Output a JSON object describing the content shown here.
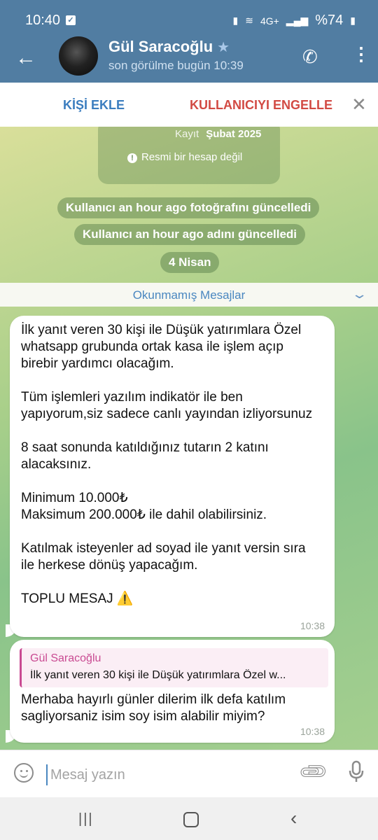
{
  "status_bar": {
    "time": "10:40",
    "network": "4G+",
    "battery": "%74"
  },
  "header": {
    "name": "Gül Saracoğlu",
    "last_seen": "son görülme bugün 10:39"
  },
  "action_bar": {
    "add_contact": "KİŞİ EKLE",
    "block_user": "KULLANICIYI ENGELLE"
  },
  "info_card": {
    "registered_label": "Kayıt",
    "registered_value": "Şubat 2025",
    "official_note": "Resmi bir hesap değil"
  },
  "service_messages": [
    "Kullanıcı an hour ago fotoğrafını güncelledi",
    "Kullanıcı an hour ago adını güncelledi"
  ],
  "date_chip": "4 Nisan",
  "unread_label": "Okunmamış Mesajlar",
  "messages": [
    {
      "text": "İlk yanıt veren 30 kişi ile Düşük yatırımlara Özel whatsapp grubunda ortak kasa ile işlem açıp birebir yardımcı olacağım.\n\nTüm işlemleri yazılım indikatör ile ben yapıyorum,siz sadece canlı yayından izliyorsunuz\n\n8 saat sonunda katıldığınız tutarın 2 katını alacaksınız.\n\nMinimum 10.000₺\nMaksimum 200.000₺  ile dahil olabilirsiniz.\n\nKatılmak isteyenler ad soyad ile yanıt versin sıra ile herkese dönüş yapacağım.\n\nTOPLU MESAJ ⚠️",
      "time": "10:38"
    },
    {
      "reply_name": "Gül Saracoğlu",
      "reply_text": "İlk yanıt veren 30 kişi ile Düşük yatırımlara Özel w...",
      "text": "Merhaba hayırlı günler dilerim ilk defa katılım sagliyorsaniz isim soy isim alabilir miyim?",
      "time": "10:38"
    }
  ],
  "composer": {
    "placeholder": "Mesaj yazın"
  },
  "icons": {
    "back": "arrow-left-icon",
    "verified": "star-icon",
    "call": "phone-icon",
    "menu": "more-vertical-icon",
    "close": "close-icon",
    "info": "info-icon",
    "chevron": "chevron-down-icon",
    "emoji": "emoji-icon",
    "attach": "paperclip-icon",
    "mic": "microphone-icon"
  },
  "colors": {
    "header": "#517da2",
    "add_contact": "#3b7dbf",
    "block_user": "#d24a43",
    "reply_accent": "#c94a92"
  }
}
